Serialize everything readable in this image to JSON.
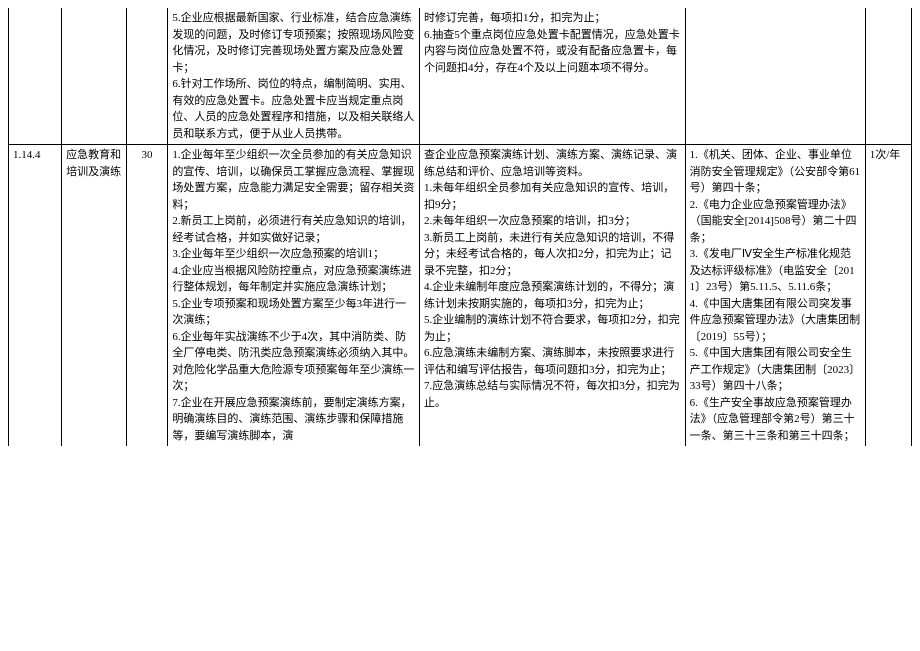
{
  "row1": {
    "c1": "",
    "c2": "",
    "c3": "",
    "c4": "5.企业应根据最新国家、行业标准，结合应急演练发现的问题，及时修订专项预案；按照现场风险变化情况，及时修订完善现场处置方案及应急处置卡；\n6.针对工作场所、岗位的特点，编制简明、实用、有效的应急处置卡。应急处置卡应当规定重点岗位、人员的应急处置程序和措施，以及相关联络人员和联系方式，便于从业人员携带。",
    "c5": "时修订完善，每项扣1分，扣完为止；\n6.抽查5个重点岗位应急处置卡配置情况，应急处置卡内容与岗位应急处置不符，或没有配备应急置卡，每个问题扣4分，存在4个及以上问题本项不得分。",
    "c6": "",
    "c7": ""
  },
  "row2": {
    "c1": "1.14.4",
    "c2": "应急教育和培训及演练",
    "c3": "30",
    "c4": "1.企业每年至少组织一次全员参加的有关应急知识的宣传、培训，以确保员工掌握应急流程、掌握现场处置方案，应急能力满足安全需要；留存相关资料；\n2.新员工上岗前，必须进行有关应急知识的培训，经考试合格，并如实做好记录；\n3.企业每年至少组织一次应急预案的培训1；\n4.企业应当根据风险防控重点，对应急预案演练进行整体规划，每年制定并实施应急演练计划；\n5.企业专项预案和现场处置方案至少每3年进行一次演练；\n6.企业每年实战演练不少于4次，其中消防类、防全厂停电类、防汛类应急预案演练必须纳入其中。对危险化学品重大危险源专项预案每年至少演练一次；\n7.企业在开展应急预案演练前，要制定演练方案，明确演练目的、演练范围、演练步骤和保障措施等，要编写演练脚本，演",
    "c5": "查企业应急预案演练计划、演练方案、演练记录、演练总结和评价、应急培训等资料。\n1.未每年组织全员参加有关应急知识的宣传、培训，扣9分；\n2.未每年组织一次应急预案的培训，扣3分；\n3.新员工上岗前，未进行有关应急知识的培训，不得分；未经考试合格的，每人次扣2分，扣完为止；记录不完整，扣2分；\n4.企业未编制年度应急预案演练计划的，不得分；演练计划未按期实施的，每项扣3分，扣完为止；\n5.企业编制的演练计划不符合要求，每项扣2分，扣完为止；\n6.应急演练未编制方案、演练脚本，未按照要求进行评估和编写评估报告，每项问题扣3分，扣完为止；\n7.应急演练总结与实际情况不符，每次扣3分，扣完为止。",
    "c6": "1.《机关、团体、企业、事业单位消防安全管理规定》（公安部令第61号）第四十条；\n2.《电力企业应急预案管理办法》（国能安全[2014]508号）第二十四条；\n3.《发电厂Ⅳ安全生产标准化规范及达标评级标准》（电监安全〔2011〕23号）第5.11.5、5.11.6条；\n4.《中国大唐集团有限公司突发事件应急预案管理办法》（大唐集团制〔2019〕55号）；\n5.《中国大唐集团有限公司安全生产工作规定》（大唐集团制〔2023〕33号）第四十八条；\n6.《生产安全事故应急预案管理办法》（应急管理部令第2号）第三十一条、第三十三条和第三十四条；",
    "c7": "1次/年"
  }
}
